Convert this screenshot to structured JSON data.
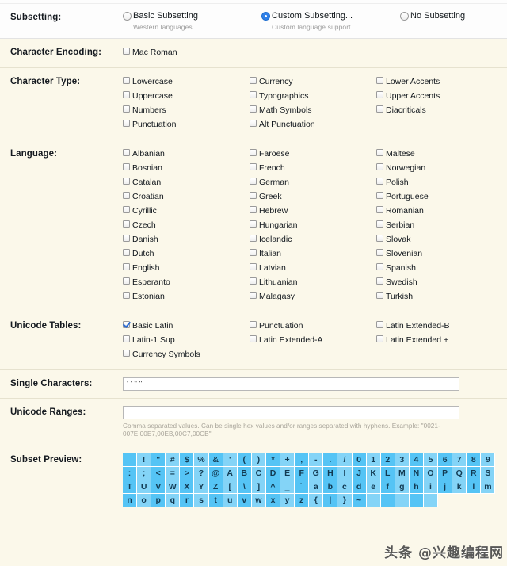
{
  "colors": {
    "section_bg": "#fbf8ea",
    "header_bg": "#fdfdfd",
    "accent": "#2f80e8",
    "preview_cell": "#55c4f5",
    "preview_cell_alt": "#84d4f7"
  },
  "sections": {
    "subsetting": {
      "label": "Subsetting:",
      "options": [
        {
          "text": "Basic Subsetting",
          "sub": "Western languages",
          "selected": false
        },
        {
          "text": "Custom Subsetting...",
          "sub": "Custom language support",
          "selected": true
        },
        {
          "text": "No Subsetting",
          "sub": "",
          "selected": false
        }
      ]
    },
    "character_encoding": {
      "label": "Character Encoding:",
      "options": [
        {
          "text": "Mac Roman",
          "checked": false
        }
      ]
    },
    "character_type": {
      "label": "Character Type:",
      "columns": [
        [
          {
            "text": "Lowercase",
            "checked": false
          },
          {
            "text": "Uppercase",
            "checked": false
          },
          {
            "text": "Numbers",
            "checked": false
          },
          {
            "text": "Punctuation",
            "checked": false
          }
        ],
        [
          {
            "text": "Currency",
            "checked": false
          },
          {
            "text": "Typographics",
            "checked": false
          },
          {
            "text": "Math Symbols",
            "checked": false
          },
          {
            "text": "Alt Punctuation",
            "checked": false
          }
        ],
        [
          {
            "text": "Lower Accents",
            "checked": false
          },
          {
            "text": "Upper Accents",
            "checked": false
          },
          {
            "text": "Diacriticals",
            "checked": false
          }
        ]
      ]
    },
    "language": {
      "label": "Language:",
      "columns": [
        [
          {
            "text": "Albanian",
            "checked": false
          },
          {
            "text": "Bosnian",
            "checked": false
          },
          {
            "text": "Catalan",
            "checked": false
          },
          {
            "text": "Croatian",
            "checked": false
          },
          {
            "text": "Cyrillic",
            "checked": false
          },
          {
            "text": "Czech",
            "checked": false
          },
          {
            "text": "Danish",
            "checked": false
          },
          {
            "text": "Dutch",
            "checked": false
          },
          {
            "text": "English",
            "checked": false
          },
          {
            "text": "Esperanto",
            "checked": false
          },
          {
            "text": "Estonian",
            "checked": false
          }
        ],
        [
          {
            "text": "Faroese",
            "checked": false
          },
          {
            "text": "French",
            "checked": false
          },
          {
            "text": "German",
            "checked": false
          },
          {
            "text": "Greek",
            "checked": false
          },
          {
            "text": "Hebrew",
            "checked": false
          },
          {
            "text": "Hungarian",
            "checked": false
          },
          {
            "text": "Icelandic",
            "checked": false
          },
          {
            "text": "Italian",
            "checked": false
          },
          {
            "text": "Latvian",
            "checked": false
          },
          {
            "text": "Lithuanian",
            "checked": false
          },
          {
            "text": "Malagasy",
            "checked": false
          }
        ],
        [
          {
            "text": "Maltese",
            "checked": false
          },
          {
            "text": "Norwegian",
            "checked": false
          },
          {
            "text": "Polish",
            "checked": false
          },
          {
            "text": "Portuguese",
            "checked": false
          },
          {
            "text": "Romanian",
            "checked": false
          },
          {
            "text": "Serbian",
            "checked": false
          },
          {
            "text": "Slovak",
            "checked": false
          },
          {
            "text": "Slovenian",
            "checked": false
          },
          {
            "text": "Spanish",
            "checked": false
          },
          {
            "text": "Swedish",
            "checked": false
          },
          {
            "text": "Turkish",
            "checked": false
          }
        ]
      ]
    },
    "unicode_tables": {
      "label": "Unicode Tables:",
      "columns": [
        [
          {
            "text": "Basic Latin",
            "checked": true
          },
          {
            "text": "Latin-1 Sup",
            "checked": false
          },
          {
            "text": "Currency Symbols",
            "checked": false
          }
        ],
        [
          {
            "text": "Punctuation",
            "checked": false
          },
          {
            "text": "Latin Extended-A",
            "checked": false
          }
        ],
        [
          {
            "text": "Latin Extended-B",
            "checked": false
          },
          {
            "text": "Latin Extended +",
            "checked": false
          }
        ]
      ]
    },
    "single_characters": {
      "label": "Single Characters:",
      "value": "' ' \" \"",
      "placeholder": ""
    },
    "unicode_ranges": {
      "label": "Unicode Ranges:",
      "value": "",
      "placeholder": "",
      "hint": "Comma separated values. Can be single hex values and/or ranges separated with hyphens. Example: \"0021-007E,00E7,00EB,00C7,00CB\""
    },
    "subset_preview": {
      "label": "Subset Preview:",
      "rows": [
        [
          " ",
          "!",
          "\"",
          "#",
          "$",
          "%",
          "&",
          "'",
          "(",
          ")",
          "*",
          "+",
          ",",
          "-",
          ".",
          "/",
          "0",
          "1",
          "2",
          "3",
          "4",
          "5",
          "6",
          "7",
          "8"
        ],
        [
          "9",
          ":",
          ";",
          "<",
          "=",
          ">",
          "?",
          "@",
          "A",
          "B",
          "C",
          "D",
          "E",
          "F",
          "G",
          "H",
          "I",
          "J",
          "K",
          "L",
          "M",
          "N",
          "O",
          "P",
          "Q"
        ],
        [
          "R",
          "S",
          "T",
          "U",
          "V",
          "W",
          "X",
          "Y",
          "Z",
          "[",
          "\\",
          "]",
          "^",
          "_",
          "`",
          "a",
          "b",
          "c",
          "d",
          "e",
          "f",
          "g",
          "h",
          "i",
          "j"
        ],
        [
          "k",
          "l",
          "m",
          "n",
          "o",
          "p",
          "q",
          "r",
          "s",
          "t",
          "u",
          "v",
          "w",
          "x",
          "y",
          "z",
          "{",
          "|",
          "}",
          "~",
          " ",
          " ",
          " ",
          " ",
          " "
        ]
      ]
    }
  },
  "watermark": {
    "text": "头条 @兴趣编程网"
  }
}
